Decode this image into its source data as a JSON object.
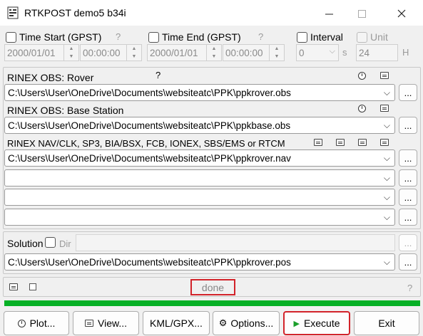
{
  "window": {
    "title": "RTKPOST demo5 b34i"
  },
  "time": {
    "start_label": "Time Start (GPST)",
    "end_label": "Time End (GPST)",
    "interval_label": "Interval",
    "unit_label": "Unit",
    "qmark": "?",
    "start_date": "2000/01/01",
    "start_time": "00:00:00",
    "end_date": "2000/01/01",
    "end_time": "00:00:00",
    "interval_value": "0",
    "interval_unit": "s",
    "unit_value": "24",
    "unit_unit": "H"
  },
  "inputs": {
    "rover_label": "RINEX OBS: Rover",
    "rover_qmark": "?",
    "rover_path": "C:\\Users\\User\\OneDrive\\Documents\\websiteatc\\PPK\\ppkrover.obs",
    "base_label": "RINEX OBS: Base Station",
    "base_path": "C:\\Users\\User\\OneDrive\\Documents\\websiteatc\\PPK\\ppkbase.obs",
    "nav_label": "RINEX NAV/CLK, SP3, BIA/BSX, FCB, IONEX, SBS/EMS  or RTCM",
    "nav_path": "C:\\Users\\User\\OneDrive\\Documents\\websiteatc\\PPK\\ppkrover.nav",
    "dots": "..."
  },
  "solution": {
    "label": "Solution",
    "dir_label": "Dir",
    "path": "C:\\Users\\User\\OneDrive\\Documents\\websiteatc\\PPK\\ppkrover.pos"
  },
  "status": {
    "message": "done",
    "qmark": "?",
    "progress_fraction": 1.0
  },
  "buttons": {
    "plot": "Plot...",
    "view": "View...",
    "kml": "KML/GPX...",
    "options": "Options...",
    "execute": "Execute",
    "exit": "Exit"
  },
  "colors": {
    "progress": "#06b025",
    "highlight": "#d2232a",
    "execute_icon": "#1a9e2a"
  }
}
